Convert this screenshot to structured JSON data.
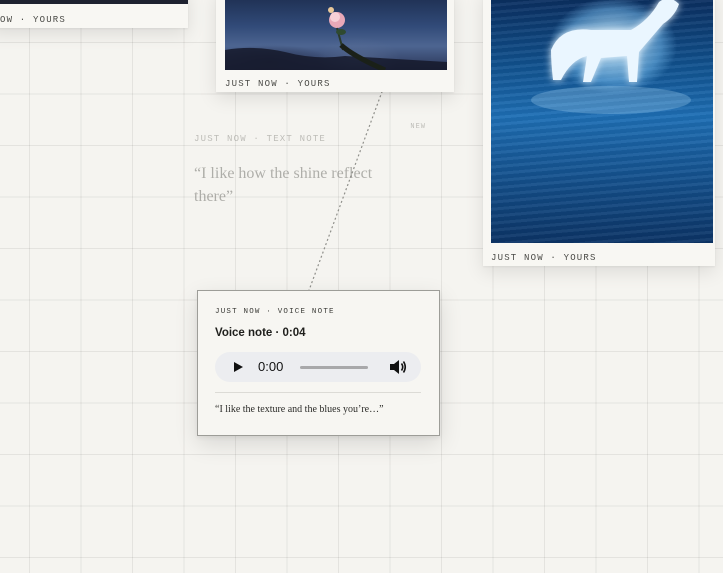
{
  "cards": [
    {
      "id": "photo-left",
      "caption": "JUST NOW · YOURS",
      "visible_caption": "OW · YOURS"
    },
    {
      "id": "photo-rose",
      "caption": "JUST NOW · YOURS"
    },
    {
      "id": "photo-horse",
      "caption": "JUST NOW · YOURS"
    }
  ],
  "text_note": {
    "caption": "JUST NOW · TEXT NOTE",
    "badge": "NEW",
    "quote": "“I like how the shine reflect there”"
  },
  "voice_note": {
    "caption": "JUST NOW · VOICE NOTE",
    "title": "Voice note · 0:04",
    "player": {
      "time": "0:00",
      "progress": 0,
      "play_icon": "play-icon",
      "volume_icon": "volume-icon"
    },
    "transcript": "“I like the texture and the blues you’re…”"
  },
  "colors": {
    "background": "#f5f4f0",
    "card": "#f8f7f3",
    "card_border": "#9d9d98",
    "player_bg": "#ecedf0"
  }
}
